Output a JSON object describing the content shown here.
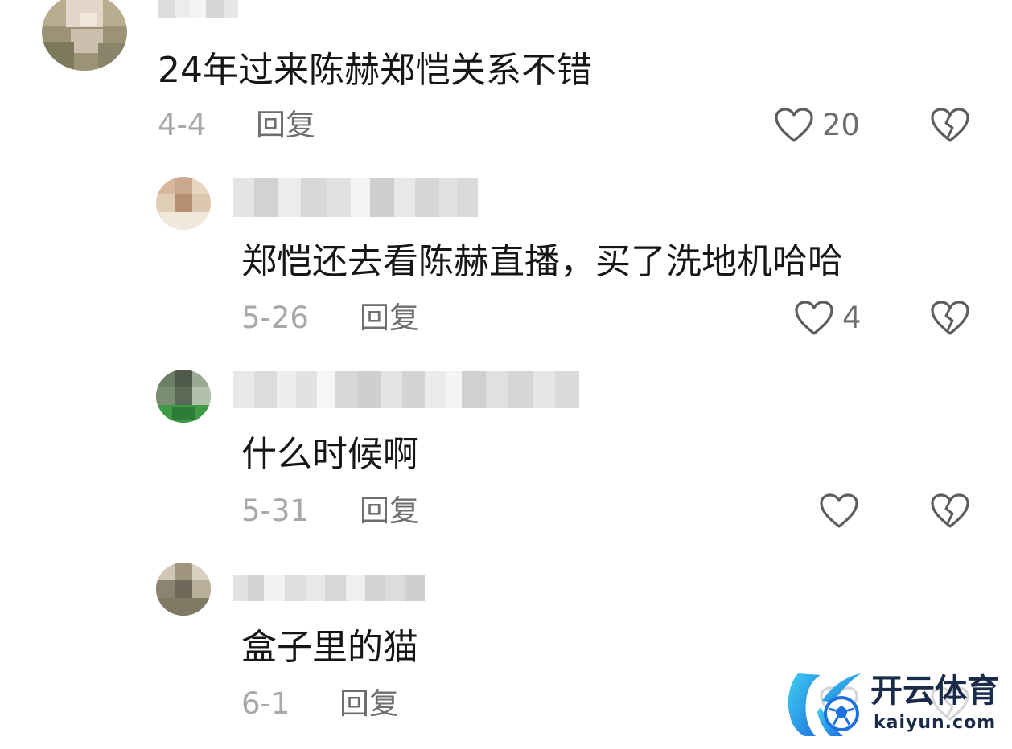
{
  "comments": [
    {
      "text": "24年过来陈赫郑恺关系不错",
      "date": "4-4",
      "reply_label": "回复",
      "likes": "20",
      "like_icon": "heart-outline-icon",
      "dislike_icon": "broken-heart-icon"
    },
    {
      "text": "郑恺还去看陈赫直播，买了洗地机哈哈",
      "date": "5-26",
      "reply_label": "回复",
      "likes": "4",
      "like_icon": "heart-outline-icon",
      "dislike_icon": "broken-heart-icon"
    },
    {
      "text": "什么时候啊",
      "date": "5-31",
      "reply_label": "回复",
      "likes": "",
      "like_icon": "heart-outline-icon",
      "dislike_icon": "broken-heart-icon"
    },
    {
      "text": "盒子里的猫",
      "date": "6-1",
      "reply_label": "回复",
      "likes": "",
      "like_icon": "heart-outline-icon",
      "dislike_icon": "broken-heart-icon"
    }
  ],
  "watermark": {
    "brand_cn": "开云体育",
    "brand_url": "kaiyun.com"
  },
  "colors": {
    "text": "#161616",
    "muted": "#a8a8a8",
    "secondary": "#6e6e6e",
    "icon": "#5c5c5c",
    "brand_blue": "#1e8fe6",
    "brand_cyan": "#3fd0f0",
    "brand_dark": "#1a2b4a"
  }
}
